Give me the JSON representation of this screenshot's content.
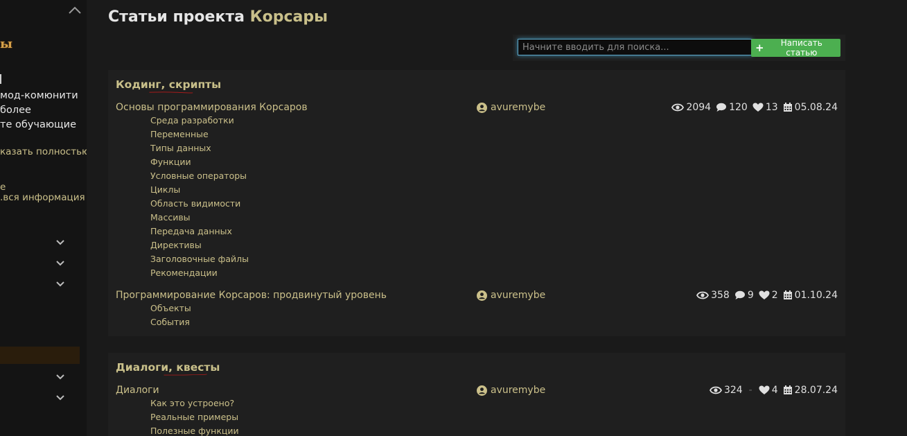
{
  "sidebar": {
    "logo_fragment": "ы",
    "text_lines": [
      "мод-комюнити",
      "более",
      "те обучающие"
    ],
    "link_show_full": "казать полностью",
    "link_lines": [
      "е",
      ".вся информация"
    ]
  },
  "header": {
    "title_prefix": "Статьи проекта",
    "title_accent": "Корсары"
  },
  "toolbar": {
    "search_placeholder": "Начните вводить для поиска...",
    "write_button_label": "Написать статью"
  },
  "colors": {
    "accent": "#c9c08a",
    "button_green": "#4caf50",
    "underline_red": "#d11a1a"
  },
  "sections": [
    {
      "title": "Кодинг, скрипты",
      "articles": [
        {
          "title": "Основы программирования Корсаров",
          "author": "avuremybe",
          "views": "2094",
          "comments": "120",
          "likes": "13",
          "date": "05.08.24",
          "subs": [
            "Среда разработки",
            "Переменные",
            "Типы данных",
            "Функции",
            "Условные операторы",
            "Циклы",
            "Область видимости",
            "Массивы",
            "Передача данных",
            "Директивы",
            "Заголовочные файлы",
            "Рекомендации"
          ]
        },
        {
          "title": "Программирование Корсаров: продвинутый уровень",
          "author": "avuremybe",
          "views": "358",
          "comments": "9",
          "likes": "2",
          "date": "01.10.24",
          "subs": [
            "Объекты",
            "События"
          ]
        }
      ]
    },
    {
      "title": "Диалоги, квесты",
      "articles": [
        {
          "title": "Диалоги",
          "author": "avuremybe",
          "views": "324",
          "comments": "-",
          "likes": "4",
          "date": "28.07.24",
          "subs": [
            "Как это устроено?",
            "Реальные примеры",
            "Полезные функции"
          ]
        }
      ]
    }
  ]
}
